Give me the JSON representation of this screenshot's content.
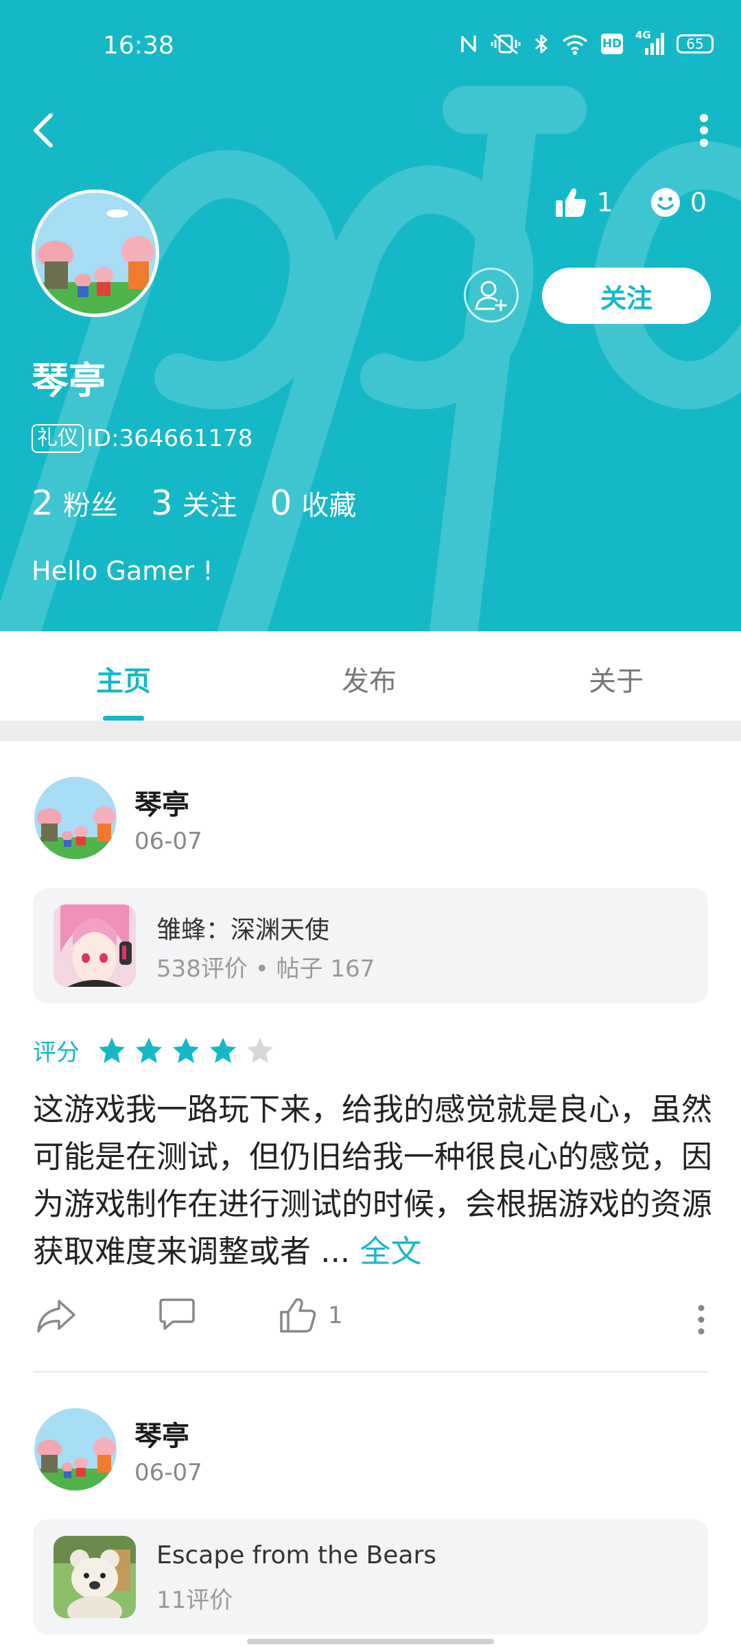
{
  "status_bar": {
    "time": "16:38",
    "hd": "HD",
    "network": "4G",
    "battery": "65"
  },
  "profile": {
    "name": "琴亭",
    "tag": "礼仪",
    "id_text": "ID:364661178",
    "likes_count": "1",
    "emoji_count": "0",
    "follow_label": "关注",
    "bio": "Hello Gamer !",
    "stats": [
      {
        "num": "2",
        "label": "粉丝"
      },
      {
        "num": "3",
        "label": "关注"
      },
      {
        "num": "0",
        "label": "收藏"
      }
    ]
  },
  "tabs": [
    {
      "label": "主页",
      "active": true
    },
    {
      "label": "发布",
      "active": false
    },
    {
      "label": "关于",
      "active": false
    }
  ],
  "posts": [
    {
      "author": "琴亭",
      "date": "06-07",
      "game_title": "雏蜂：深渊天使",
      "game_meta": "538评价 • 帖子 167",
      "rating_label": "评分",
      "rating": 4,
      "rating_max": 5,
      "review": "这游戏我一路玩下来，给我的感觉就是良心，虽然可能是在测试，但仍旧给我一种很良心的感觉，因为游戏制作在进行测试的时候，会根据游戏的资源获取难度来调整或者 ... ",
      "read_more": "全文",
      "like_count": "1"
    },
    {
      "author": "琴亭",
      "date": "06-07",
      "game_title": "Escape from the Bears",
      "game_meta": "11评价"
    }
  ],
  "colors": {
    "accent": "#15b8c6",
    "star_empty": "#d8d8d8"
  },
  "icons": [
    "back-arrow-icon",
    "more-vertical-icon",
    "thumbs-up-icon",
    "smiley-icon",
    "add-user-icon",
    "share-icon",
    "comment-icon",
    "like-icon",
    "star-icon"
  ]
}
